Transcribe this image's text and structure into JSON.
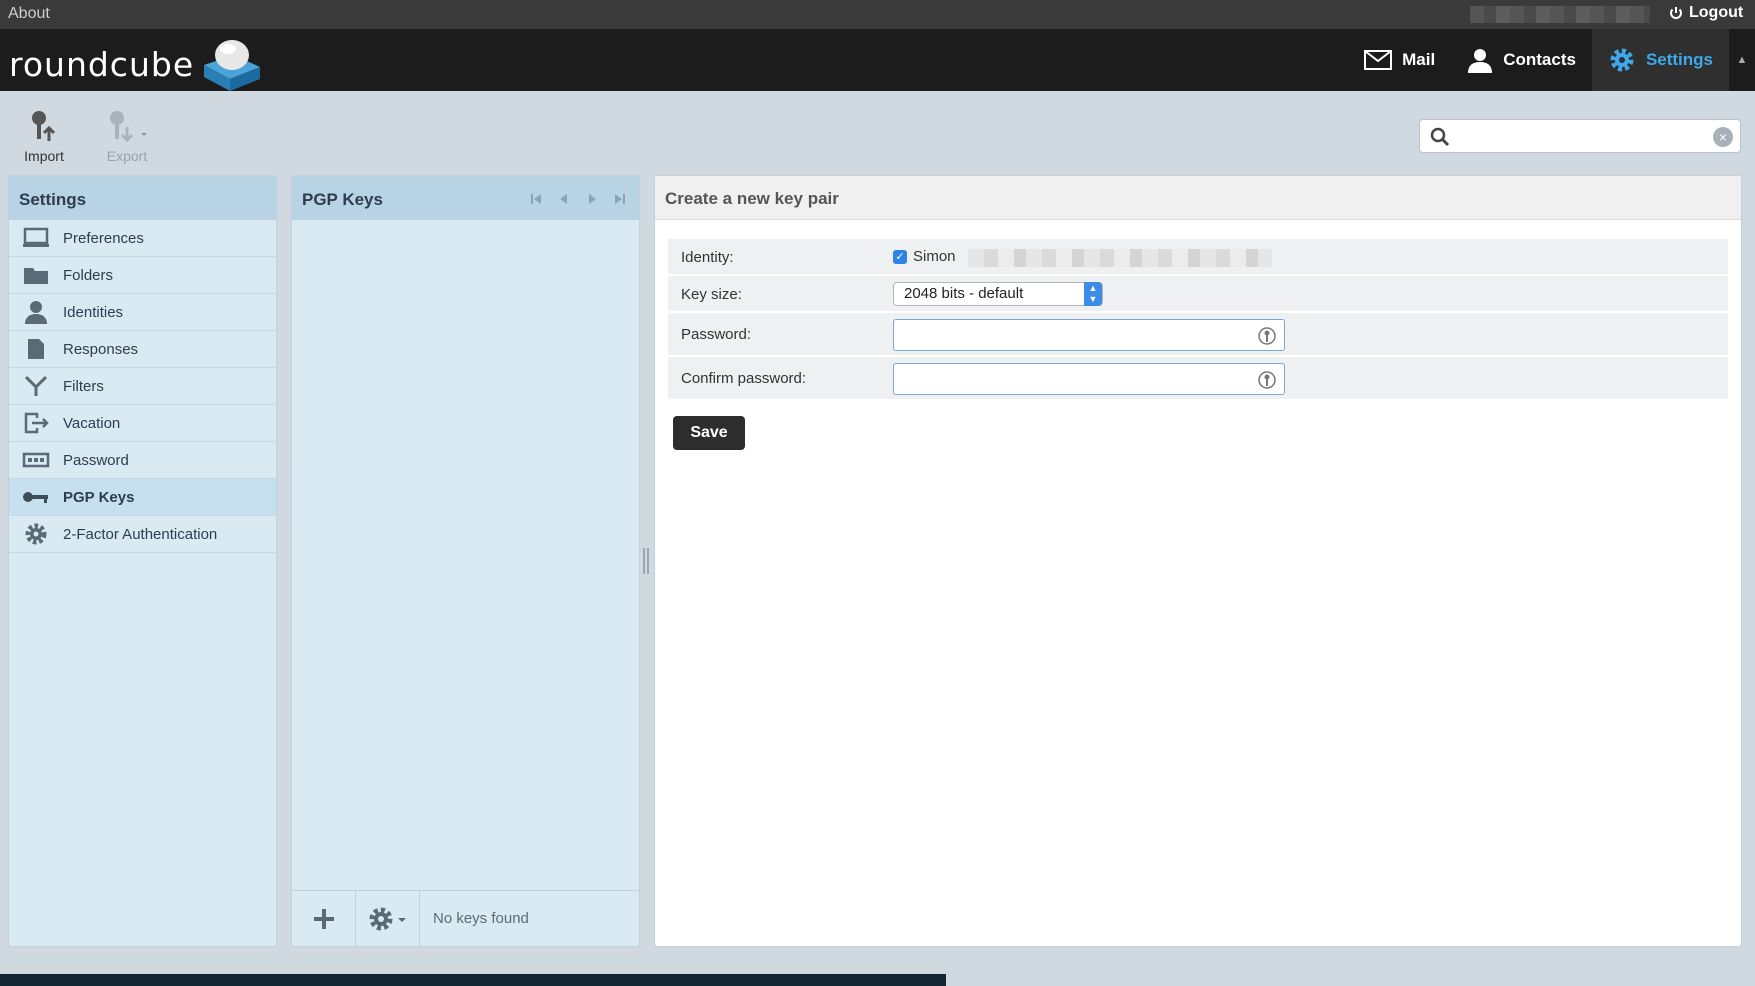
{
  "topbar": {
    "about_label": "About",
    "logout_label": "Logout"
  },
  "logo": {
    "text": "roundcube"
  },
  "nav": {
    "mail": "Mail",
    "contacts": "Contacts",
    "settings": "Settings"
  },
  "toolbar": {
    "import_label": "Import",
    "export_label": "Export"
  },
  "search": {
    "value": "",
    "placeholder": ""
  },
  "settings_panel": {
    "title": "Settings",
    "items": [
      {
        "label": "Preferences",
        "icon": "monitor-icon"
      },
      {
        "label": "Folders",
        "icon": "folder-icon"
      },
      {
        "label": "Identities",
        "icon": "person-icon"
      },
      {
        "label": "Responses",
        "icon": "document-icon"
      },
      {
        "label": "Filters",
        "icon": "filter-icon"
      },
      {
        "label": "Vacation",
        "icon": "exit-icon"
      },
      {
        "label": "Password",
        "icon": "password-icon"
      },
      {
        "label": "PGP Keys",
        "icon": "key-icon",
        "active": true
      },
      {
        "label": "2-Factor Authentication",
        "icon": "gear-icon"
      }
    ]
  },
  "pgp_panel": {
    "title": "PGP Keys",
    "empty_message": "No keys found"
  },
  "content": {
    "title": "Create a new key pair",
    "identity_label": "Identity:",
    "identity_name": "Simon",
    "identity_checked": true,
    "keysize_label": "Key size:",
    "keysize_value": "2048 bits - default",
    "password_label": "Password:",
    "password_value": "",
    "confirm_label": "Confirm password:",
    "confirm_value": "",
    "save_label": "Save"
  },
  "colors": {
    "accent": "#3ea8e8",
    "header_bg": "#1c1c1c",
    "panel_bg": "#d9eaf3",
    "panel_head": "#b8d3e3",
    "save_bg": "#2d2d2d"
  }
}
